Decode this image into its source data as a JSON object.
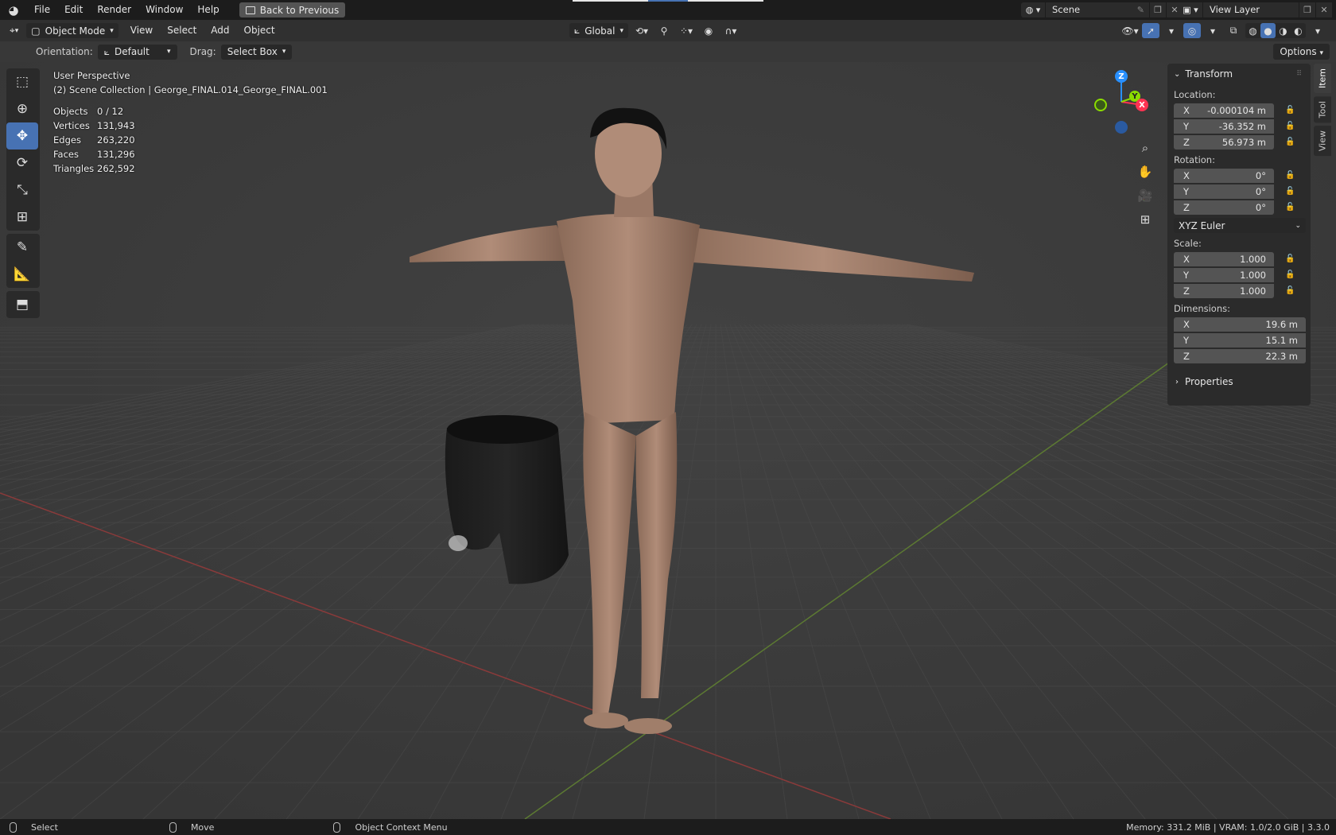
{
  "topbar": {
    "menus": [
      "File",
      "Edit",
      "Render",
      "Window",
      "Help"
    ],
    "back_button": "Back to Previous",
    "scene_label": "Scene",
    "view_layer_label": "View Layer"
  },
  "header": {
    "mode": "Object Mode",
    "menus": [
      "View",
      "Select",
      "Add",
      "Object"
    ],
    "orientation_global": "Global"
  },
  "toolsettings": {
    "orientation_label": "Orientation:",
    "orientation_value": "Default",
    "drag_label": "Drag:",
    "drag_value": "Select Box",
    "options_label": "Options"
  },
  "overlay": {
    "perspective": "User Perspective",
    "collection": "(2) Scene Collection | George_FINAL.014_George_FINAL.001",
    "stats": [
      {
        "key": "Objects",
        "value": "0 / 12"
      },
      {
        "key": "Vertices",
        "value": "131,943"
      },
      {
        "key": "Edges",
        "value": "263,220"
      },
      {
        "key": "Faces",
        "value": "131,296"
      },
      {
        "key": "Triangles",
        "value": "262,592"
      }
    ]
  },
  "gizmo": {
    "x": "X",
    "y": "Y",
    "z": "Z"
  },
  "npanel": {
    "title": "Transform",
    "location_label": "Location:",
    "location": [
      {
        "axis": "X",
        "value": "-0.000104 m"
      },
      {
        "axis": "Y",
        "value": "-36.352 m"
      },
      {
        "axis": "Z",
        "value": "56.973 m"
      }
    ],
    "rotation_label": "Rotation:",
    "rotation": [
      {
        "axis": "X",
        "value": "0°"
      },
      {
        "axis": "Y",
        "value": "0°"
      },
      {
        "axis": "Z",
        "value": "0°"
      }
    ],
    "rotation_mode": "XYZ Euler",
    "scale_label": "Scale:",
    "scale": [
      {
        "axis": "X",
        "value": "1.000"
      },
      {
        "axis": "Y",
        "value": "1.000"
      },
      {
        "axis": "Z",
        "value": "1.000"
      }
    ],
    "dimensions_label": "Dimensions:",
    "dimensions": [
      {
        "axis": "X",
        "value": "19.6 m"
      },
      {
        "axis": "Y",
        "value": "15.1 m"
      },
      {
        "axis": "Z",
        "value": "22.3 m"
      }
    ],
    "properties_label": "Properties",
    "tabs": [
      "Item",
      "Tool",
      "View"
    ]
  },
  "statusbar": {
    "select": "Select",
    "move": "Move",
    "context_menu": "Object Context Menu",
    "memory": "Memory: 331.2 MiB | VRAM: 1.0/2.0 GiB | 3.3.0"
  },
  "colors": {
    "accent": "#4772b3",
    "x_axis": "#ff3352",
    "y_axis": "#8bdc00",
    "z_axis": "#2890ff"
  }
}
